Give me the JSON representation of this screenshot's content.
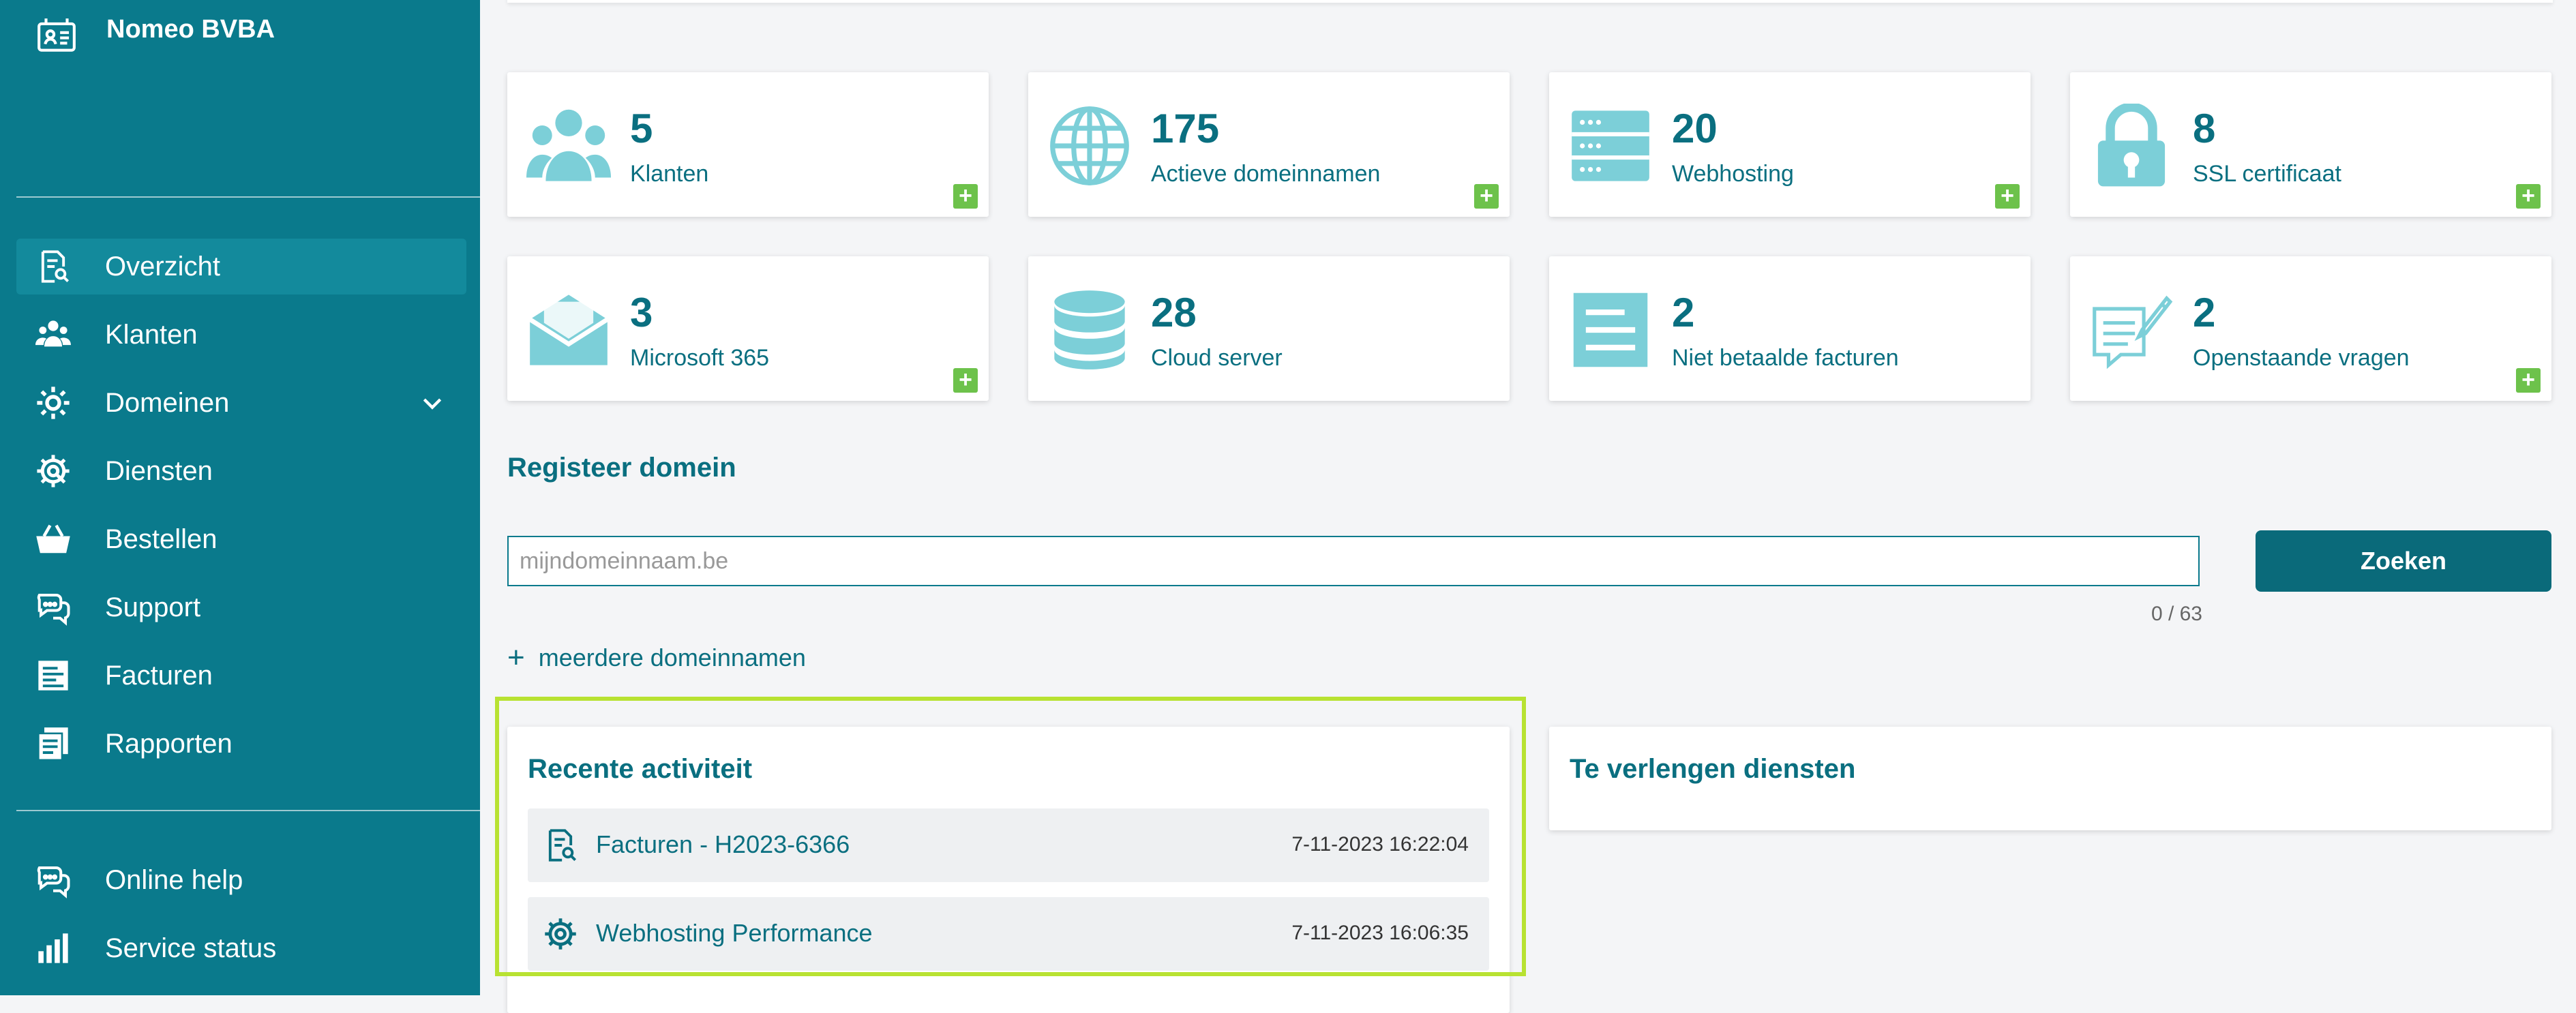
{
  "brand": {
    "name": "Nomeo BVBA"
  },
  "nav": {
    "items": [
      {
        "label": "Overzicht",
        "icon": "document-search-icon",
        "active": true
      },
      {
        "label": "Klanten",
        "icon": "users-icon"
      },
      {
        "label": "Domeinen",
        "icon": "gear-icon",
        "has_chevron": true
      },
      {
        "label": "Diensten",
        "icon": "gear-service-icon"
      },
      {
        "label": "Bestellen",
        "icon": "basket-icon"
      },
      {
        "label": "Support",
        "icon": "chat-icon"
      },
      {
        "label": "Facturen",
        "icon": "invoice-icon"
      },
      {
        "label": "Rapporten",
        "icon": "reports-icon"
      }
    ],
    "bottom": [
      {
        "label": "Online help",
        "icon": "chat-help-icon"
      },
      {
        "label": "Service status",
        "icon": "bar-chart-icon"
      }
    ]
  },
  "stats": [
    {
      "count": "5",
      "label": "Klanten",
      "icon": "users-icon",
      "plus": true
    },
    {
      "count": "175",
      "label": "Actieve domeinnamen",
      "icon": "globe-icon",
      "plus": true
    },
    {
      "count": "20",
      "label": "Webhosting",
      "icon": "server-icon",
      "plus": true
    },
    {
      "count": "8",
      "label": "SSL certificaat",
      "icon": "lock-icon",
      "plus": true
    },
    {
      "count": "3",
      "label": "Microsoft 365",
      "icon": "envelope-icon",
      "plus": true
    },
    {
      "count": "28",
      "label": "Cloud server",
      "icon": "database-icon",
      "plus": false
    },
    {
      "count": "2",
      "label": "Niet betaalde facturen",
      "icon": "invoice-lines-icon",
      "plus": false
    },
    {
      "count": "2",
      "label": "Openstaande vragen",
      "icon": "chat-form-icon",
      "plus": true
    }
  ],
  "plus_symbol": "+",
  "register": {
    "title": "Registeer domein",
    "placeholder": "mijndomeinnaam.be",
    "value": "",
    "counter": "0 / 63",
    "search_label": "Zoeken",
    "more_label": "meerdere domeinnamen",
    "more_symbol": "+"
  },
  "recent": {
    "title": "Recente activiteit",
    "items": [
      {
        "label": "Facturen - H2023-6366",
        "time": "7-11-2023 16:22:04",
        "icon": "document-search-icon"
      },
      {
        "label": "Webhosting Performance",
        "time": "7-11-2023 16:06:35",
        "icon": "gear-service-icon"
      }
    ]
  },
  "renew": {
    "title": "Te verlengen diensten"
  },
  "colors": {
    "sidebar": "#0a7a8c",
    "accent": "#0a6f80",
    "icon_teal": "#7ccfd8",
    "plus_green": "#6dc24b",
    "highlight": "#b8e232"
  }
}
